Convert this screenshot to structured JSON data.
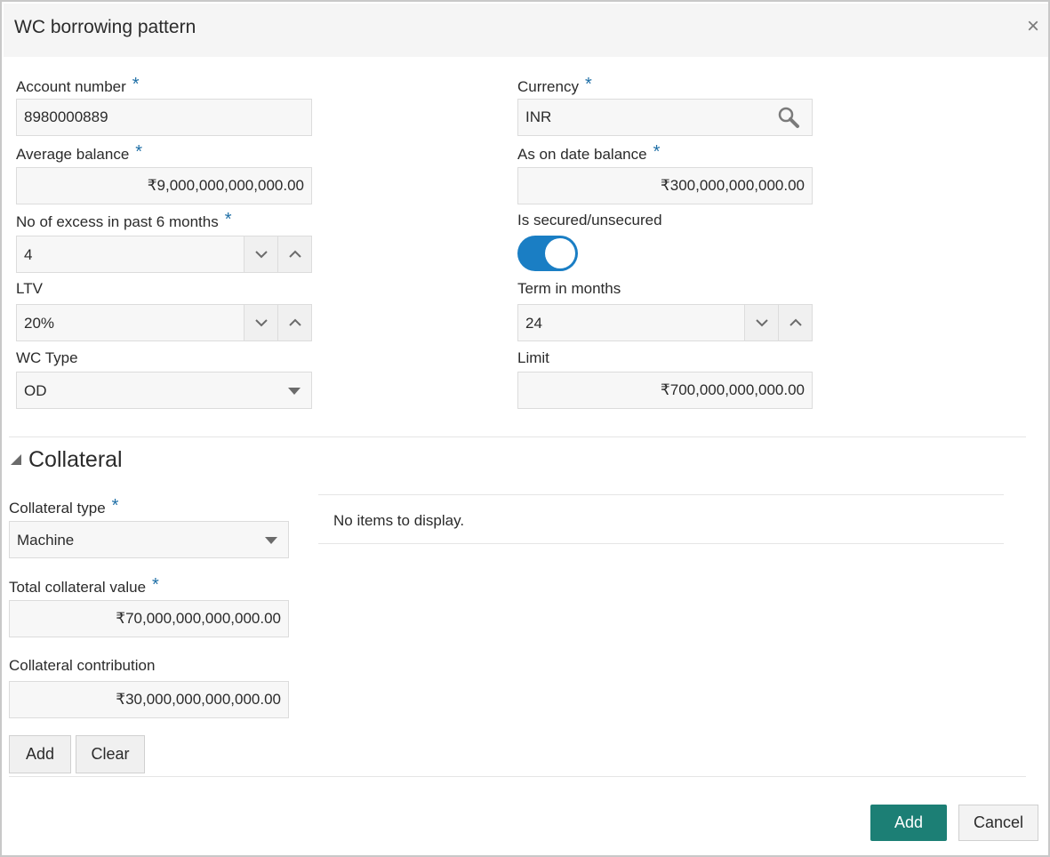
{
  "dialog": {
    "title": "WC borrowing pattern",
    "close_glyph": "×"
  },
  "form": {
    "account_number": {
      "label": "Account number",
      "value": "8980000889"
    },
    "currency": {
      "label": "Currency",
      "value": "INR",
      "icon": "search-icon"
    },
    "average_balance": {
      "label": "Average balance",
      "value": "₹9,000,000,000,000.00"
    },
    "as_on_date_balance": {
      "label": "As on date balance",
      "value": "₹300,000,000,000.00"
    },
    "excess_past_6_months": {
      "label": "No of excess in past 6 months",
      "value": "4"
    },
    "is_secured": {
      "label": "Is secured/unsecured",
      "checked": true
    },
    "ltv": {
      "label": "LTV",
      "value": "20%"
    },
    "term_in_months": {
      "label": "Term in months",
      "value": "24"
    },
    "wc_type": {
      "label": "WC Type",
      "value": "OD"
    },
    "limit": {
      "label": "Limit",
      "value": "₹700,000,000,000.00"
    },
    "required_mark": "*"
  },
  "collateral": {
    "section_title": "Collateral",
    "type": {
      "label": "Collateral type",
      "value": "Machine"
    },
    "total_value": {
      "label": "Total collateral value",
      "value": "₹70,000,000,000,000.00"
    },
    "contribution": {
      "label": "Collateral contribution",
      "value": "₹30,000,000,000,000.00"
    },
    "add_label": "Add",
    "clear_label": "Clear",
    "empty_message": "No items to display."
  },
  "footer": {
    "add_label": "Add",
    "cancel_label": "Cancel"
  },
  "colors": {
    "primary": "#1c7f75",
    "toggle": "#1a7ec4",
    "required": "#1f6fa6"
  }
}
